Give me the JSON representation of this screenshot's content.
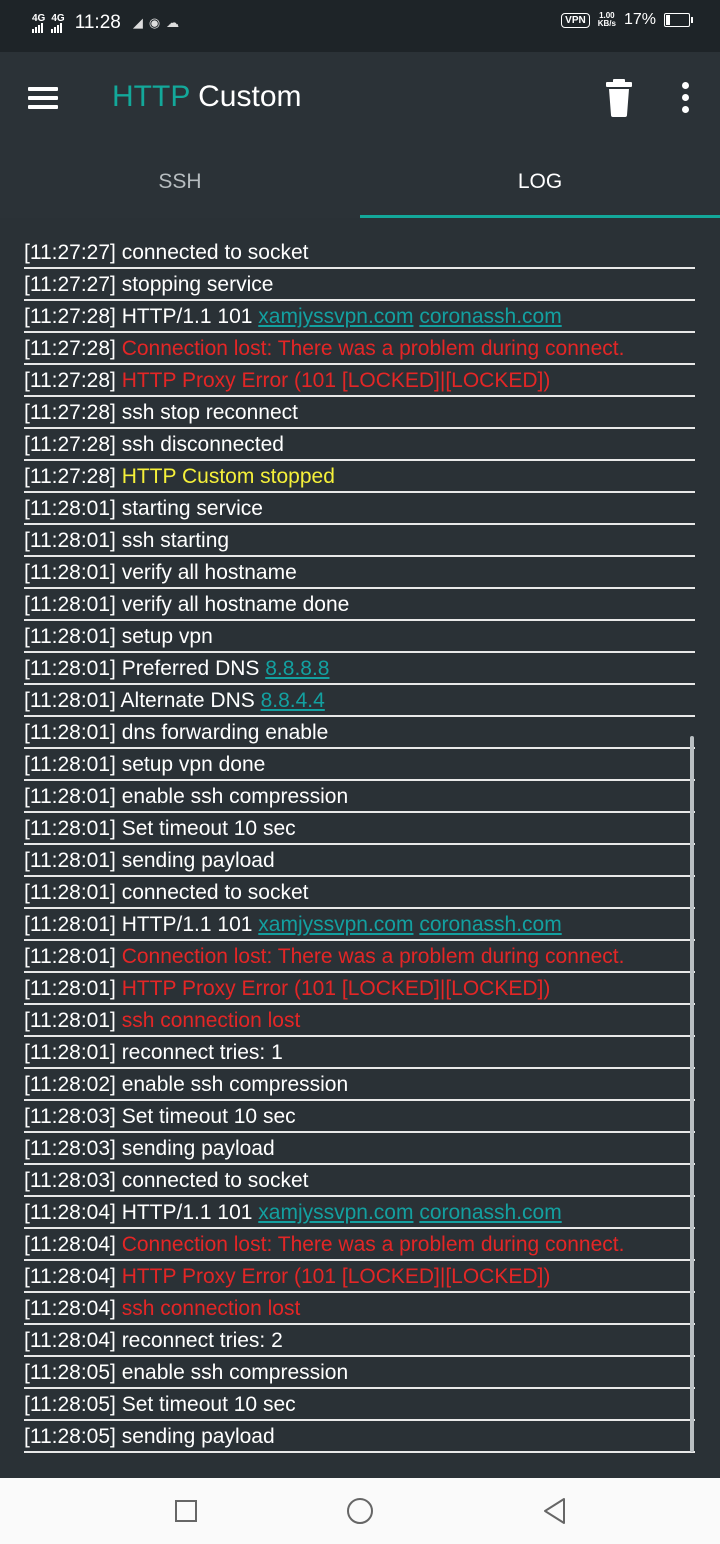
{
  "status_bar": {
    "network_1": "4G",
    "network_2": "4G",
    "time": "11:28",
    "vpn": "VPN",
    "speed_value": "1.00",
    "speed_unit": "KB/s",
    "battery_percent": "17%",
    "battery_level": 0.17
  },
  "app_bar": {
    "title_accent": "HTTP",
    "title_rest": "Custom",
    "icons": [
      "menu-icon",
      "trash-icon",
      "more-vert-icon"
    ]
  },
  "tabs": [
    {
      "label": "SSH",
      "active": false
    },
    {
      "label": "LOG",
      "active": true
    }
  ],
  "log": [
    {
      "time": "[11:27:27]",
      "parts": [
        {
          "t": " connected to socket",
          "s": "normal"
        }
      ]
    },
    {
      "time": "[11:27:27]",
      "parts": [
        {
          "t": " stopping service",
          "s": "normal"
        }
      ]
    },
    {
      "time": "[11:27:28]",
      "parts": [
        {
          "t": " HTTP/1.1 101 ",
          "s": "normal"
        },
        {
          "t": "xamjyssvpn.com",
          "s": "link"
        },
        {
          "t": " ",
          "s": "normal"
        },
        {
          "t": "coronassh.com",
          "s": "link"
        }
      ]
    },
    {
      "time": "[11:27:28]",
      "parts": [
        {
          "t": " Connection lost: There was a problem during connect.",
          "s": "red"
        }
      ]
    },
    {
      "time": "[11:27:28]",
      "parts": [
        {
          "t": " HTTP Proxy Error (101 [LOCKED]|[LOCKED])",
          "s": "red"
        }
      ]
    },
    {
      "time": "[11:27:28]",
      "parts": [
        {
          "t": " ssh stop reconnect",
          "s": "normal"
        }
      ]
    },
    {
      "time": "[11:27:28]",
      "parts": [
        {
          "t": " ssh disconnected",
          "s": "normal"
        }
      ]
    },
    {
      "time": "[11:27:28]",
      "parts": [
        {
          "t": " HTTP Custom stopped",
          "s": "yellow"
        }
      ]
    },
    {
      "time": "[11:28:01]",
      "parts": [
        {
          "t": " starting service",
          "s": "normal"
        }
      ]
    },
    {
      "time": "[11:28:01]",
      "parts": [
        {
          "t": " ssh starting",
          "s": "normal"
        }
      ]
    },
    {
      "time": "[11:28:01]",
      "parts": [
        {
          "t": " verify all hostname",
          "s": "normal"
        }
      ]
    },
    {
      "time": "[11:28:01]",
      "parts": [
        {
          "t": " verify all hostname done",
          "s": "normal"
        }
      ]
    },
    {
      "time": "[11:28:01]",
      "parts": [
        {
          "t": " setup vpn",
          "s": "normal"
        }
      ]
    },
    {
      "time": "[11:28:01]",
      "parts": [
        {
          "t": " Preferred DNS ",
          "s": "normal"
        },
        {
          "t": "8.8.8.8",
          "s": "link"
        }
      ]
    },
    {
      "time": "[11:28:01]",
      "parts": [
        {
          "t": " Alternate DNS ",
          "s": "normal"
        },
        {
          "t": "8.8.4.4",
          "s": "link"
        }
      ]
    },
    {
      "time": "[11:28:01]",
      "parts": [
        {
          "t": " dns forwarding enable",
          "s": "normal"
        }
      ]
    },
    {
      "time": "[11:28:01]",
      "parts": [
        {
          "t": " setup vpn done",
          "s": "normal"
        }
      ]
    },
    {
      "time": "[11:28:01]",
      "parts": [
        {
          "t": " enable ssh compression",
          "s": "normal"
        }
      ]
    },
    {
      "time": "[11:28:01]",
      "parts": [
        {
          "t": " Set timeout 10 sec",
          "s": "normal"
        }
      ]
    },
    {
      "time": "[11:28:01]",
      "parts": [
        {
          "t": " sending payload",
          "s": "normal"
        }
      ]
    },
    {
      "time": "[11:28:01]",
      "parts": [
        {
          "t": " connected to socket",
          "s": "normal"
        }
      ]
    },
    {
      "time": "[11:28:01]",
      "parts": [
        {
          "t": " HTTP/1.1 101 ",
          "s": "normal"
        },
        {
          "t": "xamjyssvpn.com",
          "s": "link"
        },
        {
          "t": " ",
          "s": "normal"
        },
        {
          "t": "coronassh.com",
          "s": "link"
        }
      ]
    },
    {
      "time": "[11:28:01]",
      "parts": [
        {
          "t": " Connection lost: There was a problem during connect.",
          "s": "red"
        }
      ]
    },
    {
      "time": "[11:28:01]",
      "parts": [
        {
          "t": " HTTP Proxy Error (101 [LOCKED]|[LOCKED])",
          "s": "red"
        }
      ]
    },
    {
      "time": "[11:28:01]",
      "parts": [
        {
          "t": " ssh connection lost",
          "s": "red"
        }
      ]
    },
    {
      "time": "[11:28:01]",
      "parts": [
        {
          "t": " reconnect tries: 1",
          "s": "normal"
        }
      ]
    },
    {
      "time": "[11:28:02]",
      "parts": [
        {
          "t": " enable ssh compression",
          "s": "normal"
        }
      ]
    },
    {
      "time": "[11:28:03]",
      "parts": [
        {
          "t": " Set timeout 10 sec",
          "s": "normal"
        }
      ]
    },
    {
      "time": "[11:28:03]",
      "parts": [
        {
          "t": " sending payload",
          "s": "normal"
        }
      ]
    },
    {
      "time": "[11:28:03]",
      "parts": [
        {
          "t": " connected to socket",
          "s": "normal"
        }
      ]
    },
    {
      "time": "[11:28:04]",
      "parts": [
        {
          "t": " HTTP/1.1 101 ",
          "s": "normal"
        },
        {
          "t": "xamjyssvpn.com",
          "s": "link"
        },
        {
          "t": " ",
          "s": "normal"
        },
        {
          "t": "coronassh.com",
          "s": "link"
        }
      ]
    },
    {
      "time": "[11:28:04]",
      "parts": [
        {
          "t": " Connection lost: There was a problem during connect.",
          "s": "red"
        }
      ]
    },
    {
      "time": "[11:28:04]",
      "parts": [
        {
          "t": " HTTP Proxy Error (101 [LOCKED]|[LOCKED])",
          "s": "red"
        }
      ]
    },
    {
      "time": "[11:28:04]",
      "parts": [
        {
          "t": " ssh connection lost",
          "s": "red"
        }
      ]
    },
    {
      "time": "[11:28:04]",
      "parts": [
        {
          "t": " reconnect tries: 2",
          "s": "normal"
        }
      ]
    },
    {
      "time": "[11:28:05]",
      "parts": [
        {
          "t": " enable ssh compression",
          "s": "normal"
        }
      ]
    },
    {
      "time": "[11:28:05]",
      "parts": [
        {
          "t": " Set timeout 10 sec",
          "s": "normal"
        }
      ]
    },
    {
      "time": "[11:28:05]",
      "parts": [
        {
          "t": " sending payload",
          "s": "normal"
        }
      ]
    }
  ],
  "colors": {
    "accent": "#13a89a",
    "error": "#e32626",
    "warning": "#f5f03a",
    "link": "#13a0a0",
    "background": "#2a3136"
  },
  "nav_bar": {
    "icons": [
      "recents-square-icon",
      "home-circle-icon",
      "back-triangle-icon"
    ]
  }
}
